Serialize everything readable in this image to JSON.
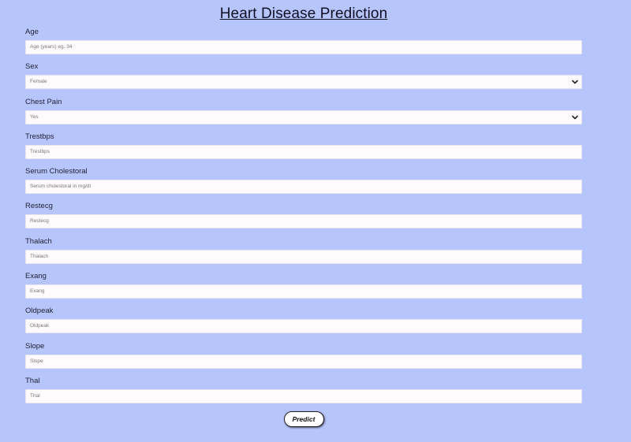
{
  "page": {
    "title": "Heart Disease Prediction"
  },
  "form": {
    "fields": [
      {
        "label": "Age",
        "type": "input",
        "placeholder": "Age (years) eg. 34"
      },
      {
        "label": "Sex",
        "type": "select",
        "value": "Female"
      },
      {
        "label": "Chest Pain",
        "type": "select",
        "value": "Yes"
      },
      {
        "label": "Trestbps",
        "type": "input",
        "placeholder": "Trestbps"
      },
      {
        "label": "Serum Cholestoral",
        "type": "input",
        "placeholder": "Serum cholestoral in mg/dl"
      },
      {
        "label": "Restecg",
        "type": "input",
        "placeholder": "Restecg"
      },
      {
        "label": "Thalach",
        "type": "input",
        "placeholder": "Thalach"
      },
      {
        "label": "Exang",
        "type": "input",
        "placeholder": "Exang"
      },
      {
        "label": "Oldpeak",
        "type": "input",
        "placeholder": "Oldpeak"
      },
      {
        "label": "Slope",
        "type": "input",
        "placeholder": "Slope"
      },
      {
        "label": "Thal",
        "type": "input",
        "placeholder": "Thal"
      }
    ],
    "submit_label": "Predict"
  },
  "colors": {
    "background": "#b7c5fd",
    "input_background": "#fffbfd"
  },
  "icons": {
    "select_arrow": "chevron-down-icon"
  }
}
